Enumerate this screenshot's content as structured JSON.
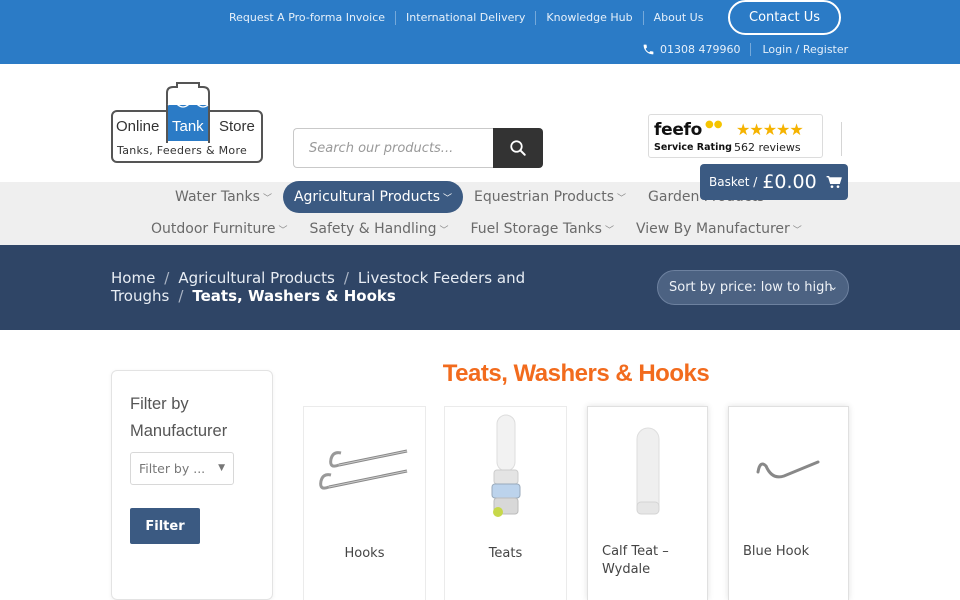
{
  "topbar": {
    "links": [
      "Request A Pro-forma Invoice",
      "International Delivery",
      "Knowledge Hub",
      "About Us"
    ],
    "contact_label": "Contact Us",
    "phone": "01308 479960",
    "login_label": "Login / Register"
  },
  "logo": {
    "line1_left": "Online",
    "line1_mid": "Tank",
    "line1_right": "Store",
    "tagline": "Tanks, Feeders & More"
  },
  "search": {
    "placeholder": "Search our products..."
  },
  "feefo": {
    "brand": "feefo",
    "subtitle": "Service Rating",
    "stars": 5,
    "reviews": "562 reviews"
  },
  "basket": {
    "label": "Basket /",
    "amount": "£0.00"
  },
  "nav": {
    "row1": [
      {
        "label": "Water Tanks",
        "active": false
      },
      {
        "label": "Agricultural Products",
        "active": true
      },
      {
        "label": "Equestrian Products",
        "active": false
      },
      {
        "label": "Garden Products",
        "active": false
      }
    ],
    "row2": [
      {
        "label": "Outdoor Furniture"
      },
      {
        "label": "Safety & Handling"
      },
      {
        "label": "Fuel Storage Tanks"
      },
      {
        "label": "View By Manufacturer"
      }
    ]
  },
  "breadcrumb": {
    "items": [
      "Home",
      "Agricultural Products",
      "Livestock Feeders and Troughs"
    ],
    "current": "Teats, Washers & Hooks"
  },
  "sort": {
    "selected": "Sort by price: low to high"
  },
  "filter": {
    "title": "Filter by Manufacturer",
    "select_value": "Filter by ...",
    "button_label": "Filter"
  },
  "category": {
    "title": "Teats, Washers & Hooks"
  },
  "products": [
    {
      "name": "Hooks",
      "image": "hooks-image"
    },
    {
      "name": "Teats",
      "image": "teat-valve-image"
    },
    {
      "name": "Calf Teat – Wydale",
      "image": "calf-teat-image"
    },
    {
      "name": "Blue Hook",
      "image": "blue-hook-image"
    }
  ],
  "colors": {
    "topbar": "#2b7bc6",
    "nav_active": "#3b5a82",
    "band": "#2f4566",
    "title_orange": "#f26b1d"
  }
}
